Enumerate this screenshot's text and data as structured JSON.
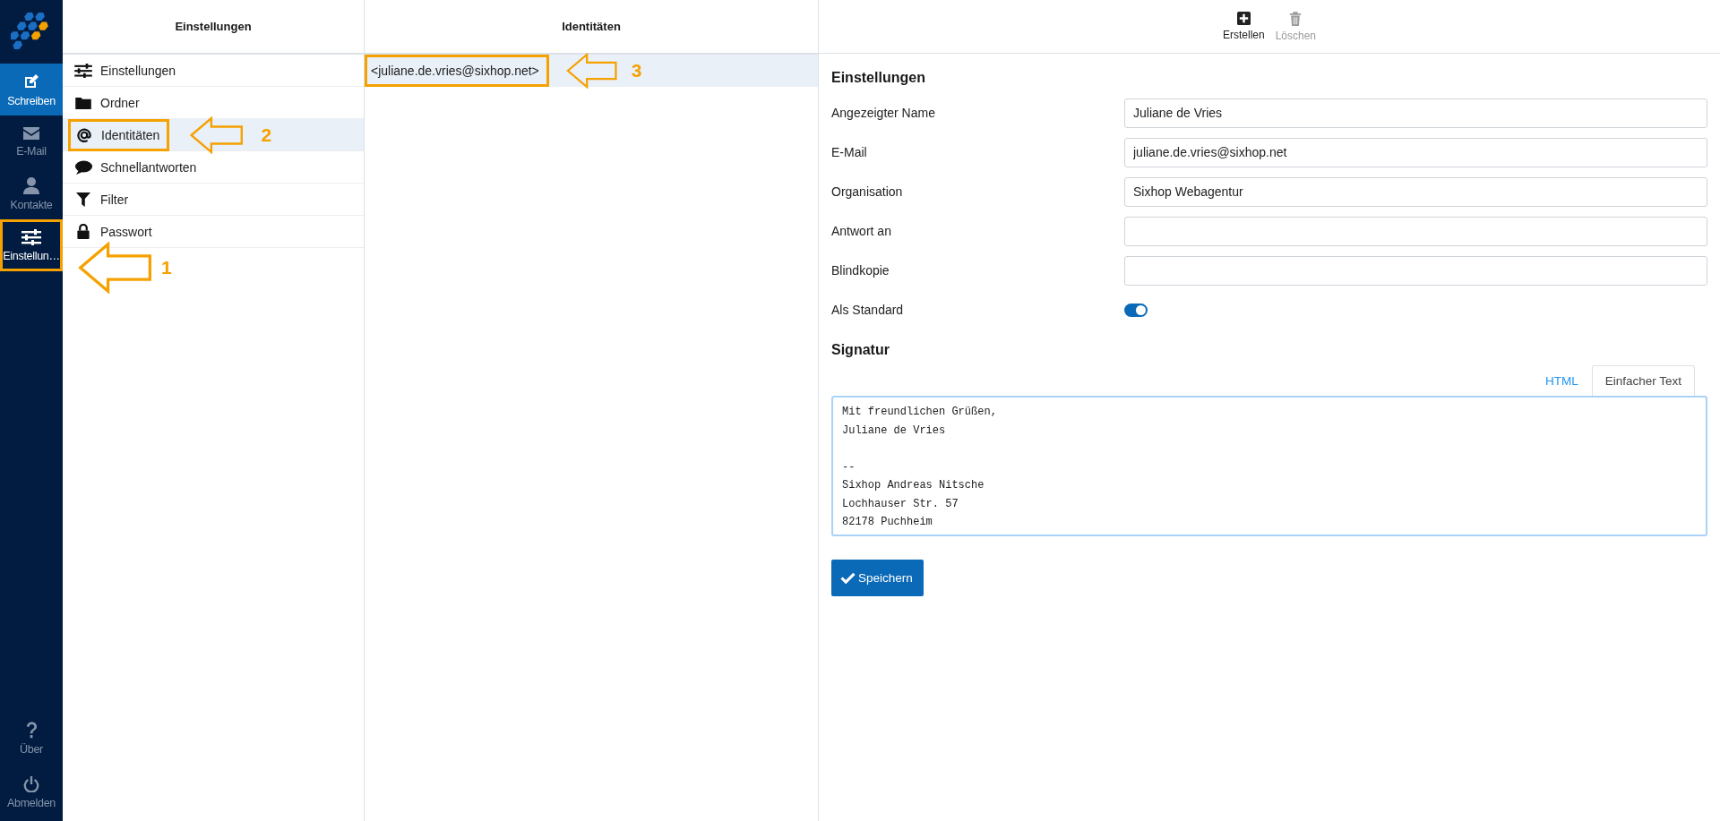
{
  "nav": {
    "items": [
      {
        "kind": "compose",
        "label": "Schreiben",
        "selected": false
      },
      {
        "kind": "mail",
        "label": "E-Mail",
        "selected": false
      },
      {
        "kind": "contacts",
        "label": "Kontakte",
        "selected": false
      },
      {
        "kind": "settings",
        "label": "Einstellun…",
        "selected": true,
        "callout": "1"
      }
    ],
    "bottom": [
      {
        "kind": "about",
        "label": "Über"
      },
      {
        "kind": "logout",
        "label": "Abmelden"
      }
    ]
  },
  "settings_panel": {
    "title": "Einstellungen",
    "items": [
      {
        "label": "Einstellungen",
        "selected": false
      },
      {
        "label": "Ordner",
        "selected": false
      },
      {
        "label": "Identitäten",
        "selected": true,
        "callout": "2"
      },
      {
        "label": "Schnellantworten",
        "selected": false
      },
      {
        "label": "Filter",
        "selected": false
      },
      {
        "label": "Passwort",
        "selected": false
      }
    ]
  },
  "identities_panel": {
    "title": "Identitäten",
    "items": [
      {
        "label": "<juliane.de.vries@sixhop.net>",
        "selected": true,
        "callout": "3"
      }
    ]
  },
  "toolbar": [
    {
      "kind": "create",
      "label": "Erstellen",
      "disabled": false
    },
    {
      "kind": "delete",
      "label": "Löschen",
      "disabled": true
    }
  ],
  "form": {
    "heading": "Einstellungen",
    "fields": [
      {
        "kind": "text",
        "label": "Angezeigter Name",
        "value": "Juliane de Vries"
      },
      {
        "kind": "text",
        "label": "E-Mail",
        "value": "juliane.de.vries@sixhop.net"
      },
      {
        "kind": "text",
        "label": "Organisation",
        "value": "Sixhop Webagentur"
      },
      {
        "kind": "text",
        "label": "Antwort an"
      },
      {
        "kind": "text",
        "label": "Blindkopie"
      },
      {
        "kind": "toggle",
        "label": "Als Standard",
        "on": true
      }
    ]
  },
  "signature": {
    "heading": "Signatur",
    "tabs": [
      {
        "label": "HTML",
        "selected": false
      },
      {
        "label": "Einfacher Text",
        "selected": true
      }
    ],
    "paragraphs": [
      [
        "Mit freundlichen Grüßen,",
        "Juliane de Vries"
      ],
      [
        "--",
        "Sixhop Andreas Nitsche",
        "Lochhauser Str. 57",
        "82178 Puchheim"
      ]
    ]
  },
  "save_button": "Speichern"
}
